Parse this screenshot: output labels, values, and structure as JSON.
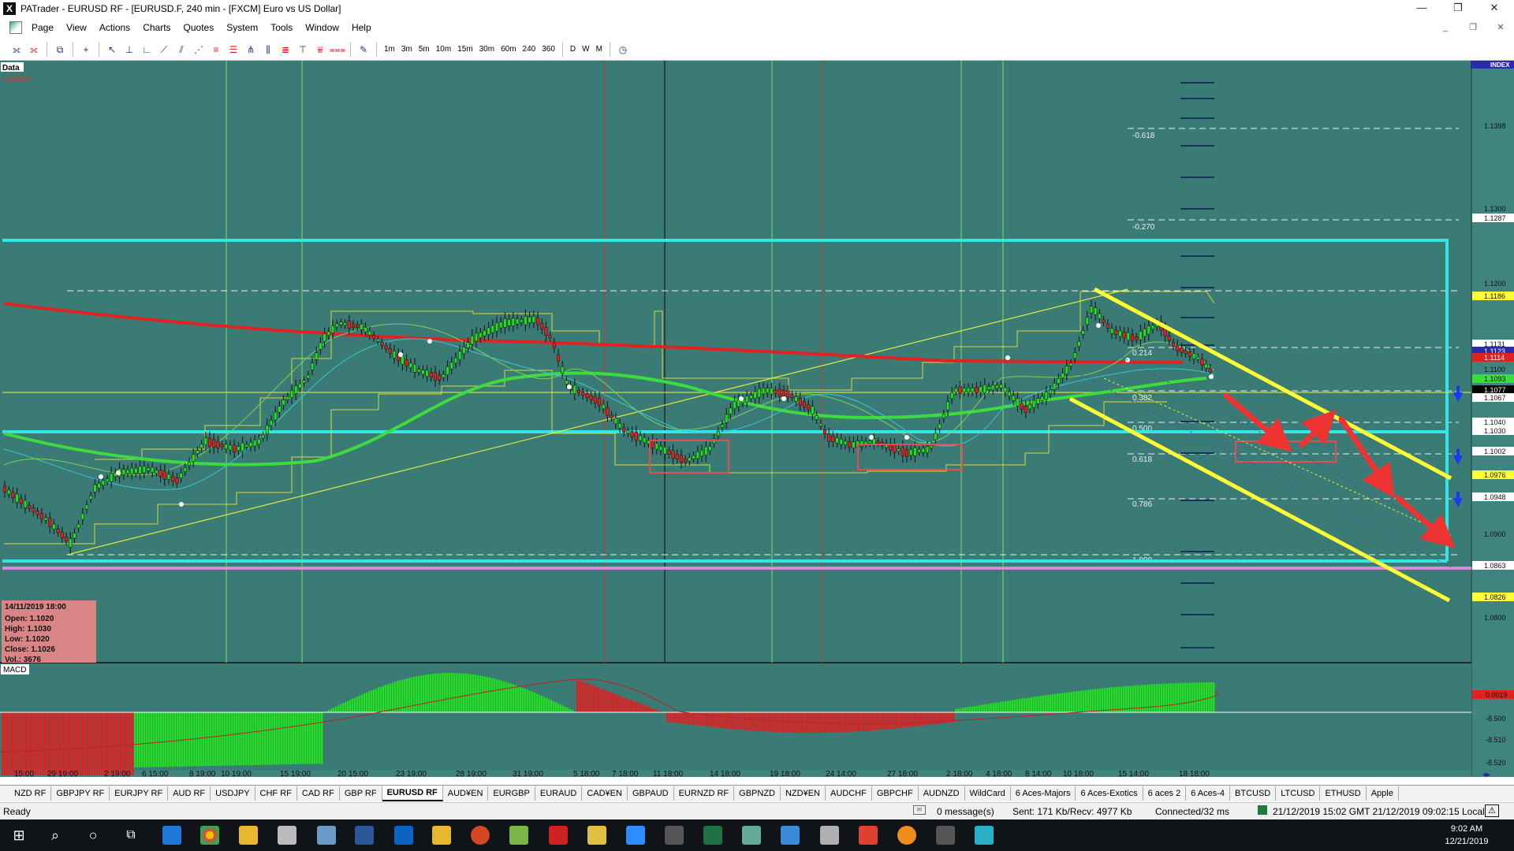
{
  "window": {
    "app_icon": "X",
    "title": "PATrader - EURUSD RF - [EURUSD.F, 240 min - [FXCM] Euro vs US Dollar]",
    "minimize": "—",
    "maximize": "❐",
    "close": "✕"
  },
  "menu": {
    "items": [
      "Page",
      "View",
      "Actions",
      "Charts",
      "Quotes",
      "System",
      "Tools",
      "Window",
      "Help"
    ],
    "mdi_min": "_",
    "mdi_restore": "❐",
    "mdi_close": "✕"
  },
  "toolbar": {
    "timeframes": [
      "1m",
      "3m",
      "5m",
      "10m",
      "15m",
      "30m",
      "60m",
      "240",
      "360"
    ],
    "periods": [
      "D",
      "W",
      "M"
    ]
  },
  "chart": {
    "data_label": "Data",
    "locked_label": "Locked",
    "index_label": "INDEX",
    "macd_label": "MACD",
    "info_box": {
      "date": "14/11/2019 18:00",
      "open": "Open: 1.1020",
      "high": "High: 1.1030",
      "low": "Low: 1.1020",
      "close": "Close: 1.1026",
      "vol": "Vol.: 3676"
    },
    "fib_labels": [
      "-0.618",
      "-0.270",
      "0.214",
      "0.382",
      "0.500",
      "0.618",
      "0.786",
      "1.000"
    ],
    "price_labels": [
      "1.1398",
      "1.1300",
      "1.1287",
      "1.1200",
      "1.1186",
      "1.1131",
      "1.1123",
      "1.1114",
      "1.1100",
      "1.1093",
      "1.1077",
      "1.1067",
      "1.1040",
      "1.1030",
      "1.1002",
      "1.0976",
      "1.0948",
      "1.0900",
      "1.0863",
      "1.0826",
      "1.0800"
    ],
    "macd_scale": [
      "0.0019",
      "-8.500",
      "-8.510",
      "-8.520"
    ],
    "time_labels": [
      "15:00",
      "29 19:00",
      "2 19:00",
      "6 15:00",
      "8 19:00",
      "10 19:00",
      "15 19:00",
      "20 15:00",
      "23 19:00",
      "28 19:00",
      "31 19:00",
      "5 18:00",
      "7 18:00",
      "11 18:00",
      "14 18:00",
      "19 18:00",
      "24 14:00",
      "27 18:00",
      "2 18:00",
      "4 18:00",
      "8 14:00",
      "10 18:00",
      "15 14:00",
      "18 18:00"
    ],
    "colors": {
      "background": "#3a7b76",
      "bull": "#22e01e",
      "bear": "#e02020",
      "cyan": "#33e6e6",
      "yellow": "#ffff33",
      "ma_red": "#e02222",
      "ma_green": "#3ddc3d",
      "fib_box": "#e05050",
      "arrow": "#ee3333"
    }
  },
  "tabs": [
    "NZD RF",
    "GBPJPY RF",
    "EURJPY RF",
    "AUD RF",
    "USDJPY",
    "CHF RF",
    "CAD RF",
    "GBP RF",
    "EURUSD RF",
    "AUD¥EN",
    "EURGBP",
    "EURAUD",
    "CAD¥EN",
    "GBPAUD",
    "EURNZD RF",
    "GBPNZD",
    "NZD¥EN",
    "AUDCHF",
    "GBPCHF",
    "AUDNZD",
    "WildCard",
    "6 Aces-Majors",
    "6 Aces-Exotics",
    "6 aces 2",
    "6 Aces-4",
    "BTCUSD",
    "LTCUSD",
    "ETHUSD",
    "Apple"
  ],
  "active_tab": "EURUSD RF",
  "status": {
    "ready": "Ready",
    "messages": "0 message(s)",
    "traffic": "Sent: 171 Kb/Recv: 4977 Kb",
    "connection": "Connected/32 ms",
    "time": "21/12/2019 15:02 GMT  21/12/2019 09:02:15 Local"
  },
  "taskbar": {
    "clock_time": "9:02 AM",
    "clock_date": "12/21/2019"
  }
}
